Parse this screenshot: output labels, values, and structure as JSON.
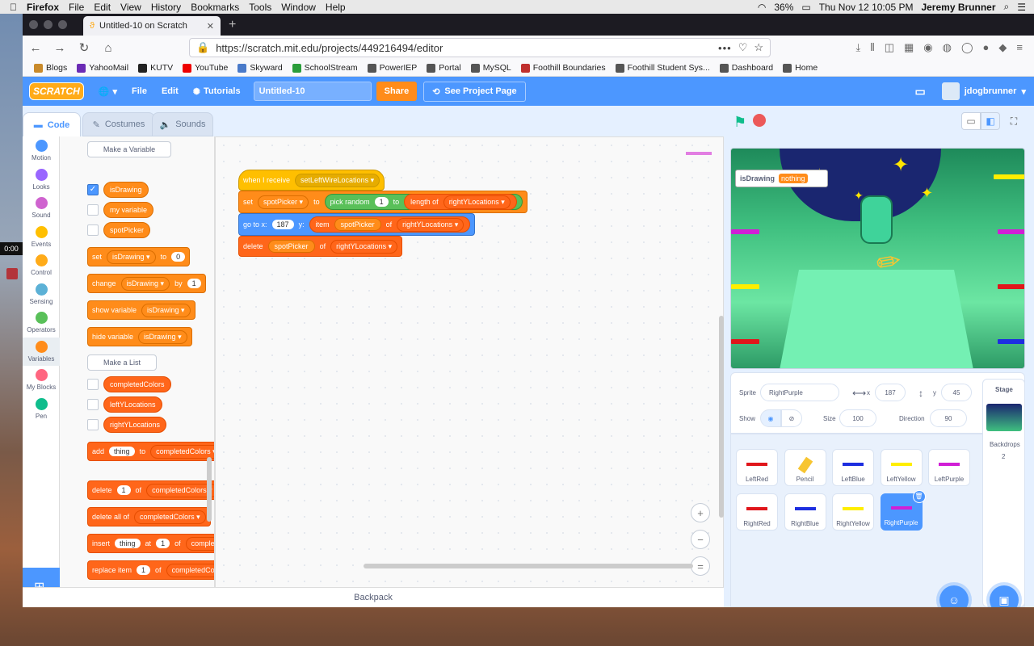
{
  "menubar": {
    "app": "Firefox",
    "items": [
      "File",
      "Edit",
      "View",
      "History",
      "Bookmarks",
      "Tools",
      "Window",
      "Help"
    ],
    "battery": "36%",
    "clock": "Thu Nov 12  10:05 PM",
    "user": "Jeremy Brunner"
  },
  "tab": {
    "title": "Untitled-10 on Scratch"
  },
  "url": "https://scratch.mit.edu/projects/449216494/editor",
  "bookmarks": [
    "Blogs",
    "YahooMail",
    "KUTV",
    "YouTube",
    "Skyward",
    "SchoolStream",
    "PowerIEP",
    "Portal",
    "MySQL",
    "Foothill Boundaries",
    "Foothill Student Sys...",
    "Dashboard",
    "Home"
  ],
  "bookmark_colors": [
    "#c98a2b",
    "#6b2bb5",
    "#222",
    "#e00",
    "#4a7ac9",
    "#2a9d3a",
    "#555",
    "#555",
    "#555",
    "#c0302e",
    "#555",
    "#555",
    "#555"
  ],
  "scratch": {
    "logo": "SCRATCH",
    "file": "File",
    "edit": "Edit",
    "tutorials": "Tutorials",
    "title": "Untitled-10",
    "share": "Share",
    "see_project": "See Project Page",
    "username": "jdogbrunner"
  },
  "tabs": {
    "code": "Code",
    "costumes": "Costumes",
    "sounds": "Sounds"
  },
  "categories": [
    {
      "label": "Motion",
      "color": "#4c97ff"
    },
    {
      "label": "Looks",
      "color": "#9966ff"
    },
    {
      "label": "Sound",
      "color": "#cf63cf"
    },
    {
      "label": "Events",
      "color": "#ffbf00"
    },
    {
      "label": "Control",
      "color": "#ffab19"
    },
    {
      "label": "Sensing",
      "color": "#5cb1d6"
    },
    {
      "label": "Operators",
      "color": "#59c059"
    },
    {
      "label": "Variables",
      "color": "#ff8c1a"
    },
    {
      "label": "My Blocks",
      "color": "#ff6680"
    },
    {
      "label": "Pen",
      "color": "#0fbd8c"
    }
  ],
  "palette": {
    "section": "Variables",
    "make_variable": "Make a Variable",
    "vars": [
      "isDrawing",
      "my variable",
      "spotPicker"
    ],
    "set": {
      "a": "set",
      "var": "isDrawing",
      "b": "to",
      "val": "0"
    },
    "change": {
      "a": "change",
      "var": "isDrawing",
      "b": "by",
      "val": "1"
    },
    "show": {
      "a": "show variable",
      "var": "isDrawing"
    },
    "hide": {
      "a": "hide variable",
      "var": "isDrawing"
    },
    "make_list": "Make a List",
    "lists": [
      "completedColors",
      "leftYLocations",
      "rightYLocations"
    ],
    "add": {
      "a": "add",
      "val": "thing",
      "b": "to",
      "list": "completedColors"
    },
    "delete": {
      "a": "delete",
      "val": "1",
      "b": "of",
      "list": "completedColors"
    },
    "delete_all": {
      "a": "delete all of",
      "list": "completedColors"
    },
    "insert": {
      "a": "insert",
      "val": "thing",
      "b": "at",
      "idx": "1",
      "c": "of",
      "list": "completedColors"
    },
    "replace": {
      "a": "replace item",
      "val": "1",
      "b": "of",
      "list": "completedColors"
    }
  },
  "script": {
    "hat": {
      "a": "when I receive",
      "msg": "setLeftWireLocations"
    },
    "set": {
      "a": "set",
      "var": "spotPicker",
      "b": "to",
      "op": "pick random",
      "from": "1",
      "c": "to",
      "len": "length of",
      "list": "rightYLocations"
    },
    "goto": {
      "a": "go to x:",
      "x": "187",
      "b": "y:",
      "item": "item",
      "var": "spotPicker",
      "c": "of",
      "list": "rightYLocations"
    },
    "del": {
      "a": "delete",
      "var": "spotPicker",
      "b": "of",
      "list": "rightYLocations"
    }
  },
  "zoom": {
    "in": "+",
    "out": "−",
    "reset": "="
  },
  "backpack": "Backpack",
  "stage": {
    "monitor_label": "isDrawing",
    "monitor_value": "nothing"
  },
  "sprite_info": {
    "sprite_label": "Sprite",
    "name": "RightPurple",
    "x_label": "x",
    "x": "187",
    "y_label": "y",
    "y": "45",
    "show_label": "Show",
    "size_label": "Size",
    "size": "100",
    "direction_label": "Direction",
    "direction": "90"
  },
  "sprites": [
    {
      "name": "LeftRed",
      "color": "#e0161b"
    },
    {
      "name": "Pencil",
      "color": "#f7c531"
    },
    {
      "name": "LeftBlue",
      "color": "#1d2ee0"
    },
    {
      "name": "LeftYellow",
      "color": "#ffee00"
    },
    {
      "name": "LeftPurple",
      "color": "#d11ed6"
    },
    {
      "name": "RightRed",
      "color": "#e0161b"
    },
    {
      "name": "RightBlue",
      "color": "#1d2ee0"
    },
    {
      "name": "RightYellow",
      "color": "#ffee00"
    },
    {
      "name": "RightPurple",
      "color": "#d11ed6",
      "selected": true
    }
  ],
  "stage_panel": {
    "title": "Stage",
    "backdrops_label": "Backdrops",
    "backdrops": "2"
  },
  "recorder": {
    "time": "0:00"
  }
}
